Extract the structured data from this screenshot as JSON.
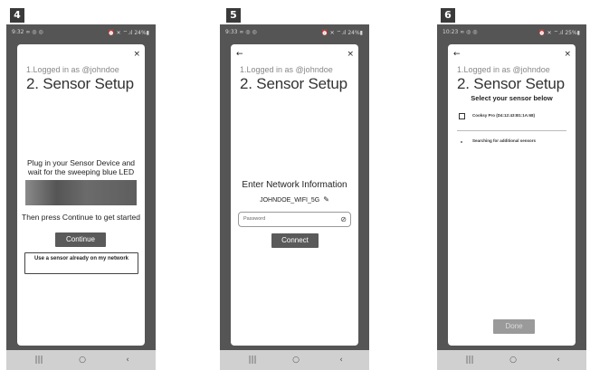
{
  "screens": [
    {
      "step_number": "4",
      "status_time": "9:32",
      "status_left_icons": "∞ ◎ ◎",
      "status_right": "⏰ ✕ ⌔.ıl 24%▮",
      "close_glyph": "×",
      "step1_text": "1.Logged in as @johndoe",
      "step2_text": "2. Sensor Setup",
      "instruction_line1": "Plug in your Sensor Device and",
      "instruction_line2": "wait for the sweeping blue LED",
      "instruction_continue": "Then press Continue to get started",
      "continue_label": "Continue",
      "existing_sensor_label": "Use a sensor already on my network",
      "nav": {
        "recent": "|||",
        "home": "○",
        "back": "‹"
      }
    },
    {
      "step_number": "5",
      "status_time": "9:33",
      "status_left_icons": "∞ ◎ ◎",
      "status_right": "⏰ ✕ ⌔.ıl 24%▮",
      "back_glyph": "←",
      "close_glyph": "×",
      "step1_text": "1.Logged in as @johndoe",
      "step2_text": "2. Sensor Setup",
      "network_title": "Enter Network Information",
      "ssid": "JOHNDOE_WIFI_5G",
      "pencil_glyph": "✎",
      "password_placeholder": "Password",
      "eye_glyph": "⊘",
      "connect_label": "Connect",
      "nav": {
        "recent": "|||",
        "home": "○",
        "back": "‹"
      }
    },
    {
      "step_number": "6",
      "status_time": "10:23",
      "status_left_icons": "∞ ◎ ◎",
      "status_right": "⏰ ✕ ⌔.ıl 25%▮",
      "back_glyph": "←",
      "close_glyph": "×",
      "step1_text": "1.Logged in as @johndoe",
      "step2_text": "2. Sensor Setup",
      "select_title": "Select your sensor below",
      "sensor_label": "Cooksy Pro (D4:12:43:B1:1A:68)",
      "searching_label": "Searching for additional sensors",
      "done_label": "Done",
      "nav": {
        "recent": "|||",
        "home": "○",
        "back": "‹"
      }
    }
  ]
}
